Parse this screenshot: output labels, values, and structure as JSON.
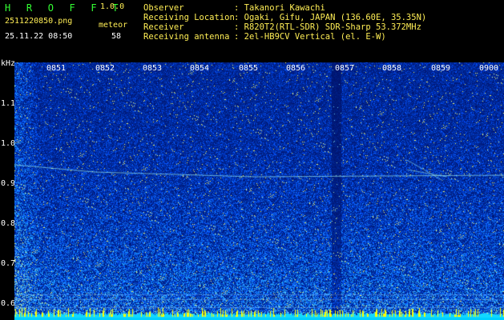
{
  "header": {
    "brand": "H R O F F T",
    "version": "1.0.0",
    "filename": "2511220850.png",
    "meteor_label": "meteor",
    "datetime": "25.11.22 08:50",
    "meteor_count": "58"
  },
  "info": [
    {
      "label": "Observer",
      "value": ": Takanori Kawachi"
    },
    {
      "label": "Receiving Location",
      "value": ": Ogaki, Gifu, JAPAN (136.60E, 35.35N)"
    },
    {
      "label": "Receiver",
      "value": ": R820T2(RTL-SDR) SDR-Sharp 53.372MHz"
    },
    {
      "label": "Receiving antenna",
      "value": ": 2el-HB9CV Vertical (el. E-W)"
    }
  ],
  "spectrogram": {
    "y_unit": "kHz",
    "y_ticks": [
      "1.1",
      "1.0",
      "0.9",
      "0.8",
      "0.7",
      "0.6"
    ],
    "x_ticks": [
      "0851",
      "0852",
      "0853",
      "0854",
      "0855",
      "0856",
      "0857",
      "0858",
      "0859",
      "0900"
    ],
    "colors": {
      "background": "#000000",
      "low": "#001a8c",
      "mid": "#1f6aff",
      "high": "#ffff00",
      "tick": "#ffff55"
    }
  }
}
